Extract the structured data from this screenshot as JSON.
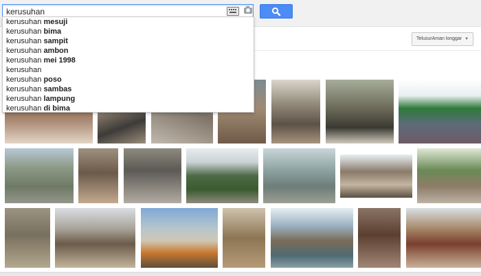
{
  "search": {
    "query": "kerusuhan",
    "keyboard_icon": "keyboard-icon",
    "camera_icon": "camera-icon",
    "button_icon": "magnifier-icon"
  },
  "suggestions": [
    {
      "prefix": "kerusuhan",
      "suffix": "mesuji"
    },
    {
      "prefix": "kerusuhan",
      "suffix": "bima"
    },
    {
      "prefix": "kerusuhan",
      "suffix": "sampit"
    },
    {
      "prefix": "kerusuhan",
      "suffix": "ambon"
    },
    {
      "prefix": "kerusuhan",
      "suffix": "mei 1998"
    },
    {
      "prefix": "kerusuhan",
      "suffix": ""
    },
    {
      "prefix": "kerusuhan",
      "suffix": "poso"
    },
    {
      "prefix": "kerusuhan",
      "suffix": "sambas"
    },
    {
      "prefix": "kerusuhan",
      "suffix": "lampung"
    },
    {
      "prefix": "kerusuhan",
      "suffix": "di bima"
    }
  ],
  "safesearch": {
    "label": "TelusurAman longgar",
    "chevron_icon": "caret-down-icon"
  },
  "colors": {
    "accent": "#4d8bf5",
    "topbar": "#f1f1f1"
  }
}
